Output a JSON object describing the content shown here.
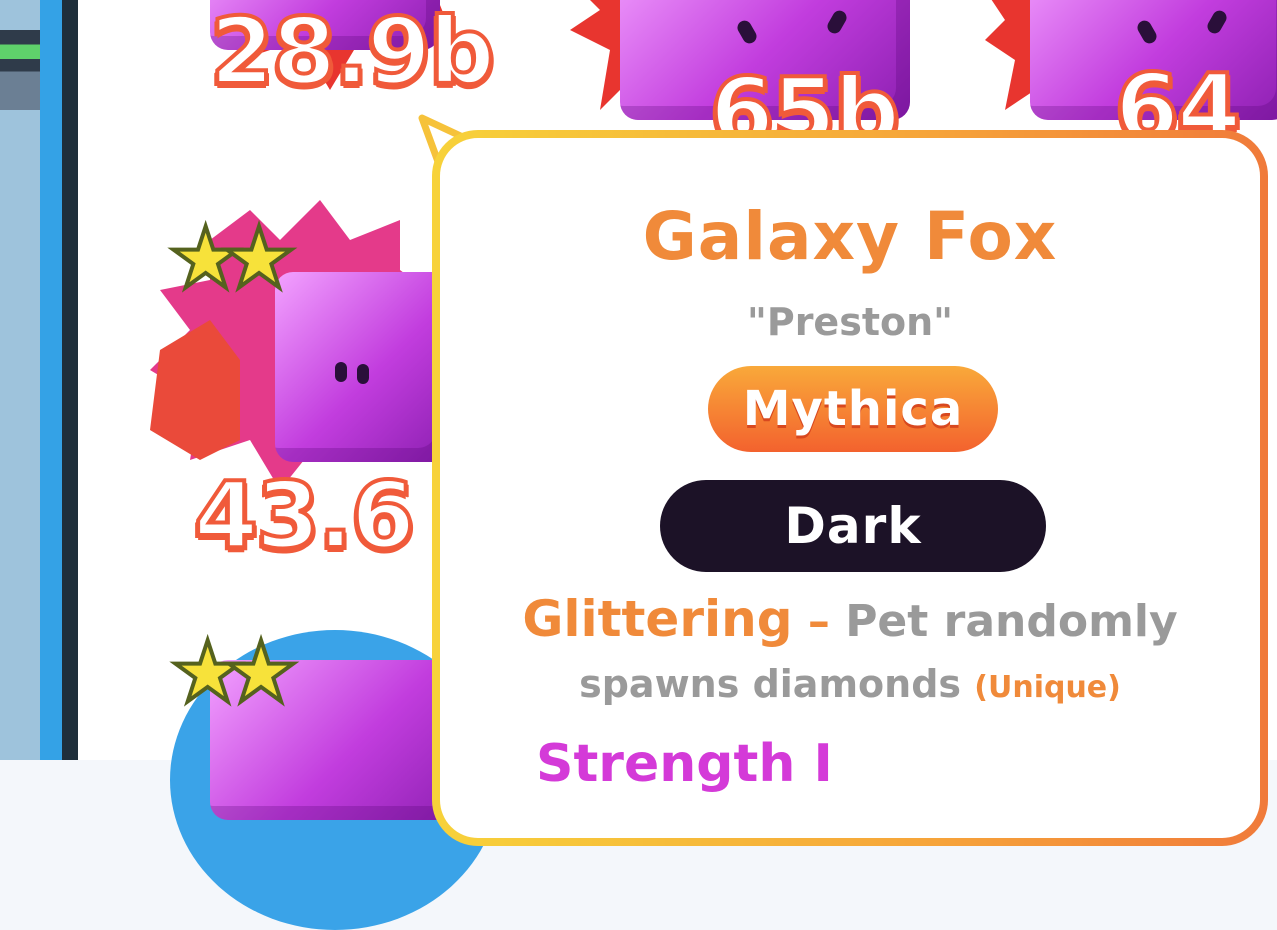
{
  "pets": [
    {
      "amount": "28.9b",
      "stars": 0
    },
    {
      "amount": "65b",
      "stars": 0
    },
    {
      "amount": "64",
      "stars": 0
    },
    {
      "amount": "43.6",
      "stars": 2
    },
    {
      "amount": "",
      "stars": 2
    }
  ],
  "tooltip": {
    "name": "Galaxy Fox",
    "nickname": "\"Preston\"",
    "rarity": "Mythica",
    "variant": "Dark",
    "ability": {
      "name": "Glittering",
      "dash": "–",
      "desc_part1": "Pet randomly",
      "desc_part2": "spawns diamonds",
      "tag": "(Unique)"
    },
    "ability2": {
      "name": "Strength I",
      "desc": ""
    }
  },
  "colors": {
    "accent_orange": "#f08a3a",
    "amount_stroke": "#f05a3a",
    "pet_purple": "#c23dde",
    "dark_pill": "#1c1227",
    "strength_pink": "#d43ad8"
  },
  "icons": [
    "star-icon",
    "starburst-icon",
    "pet-cube-icon"
  ]
}
